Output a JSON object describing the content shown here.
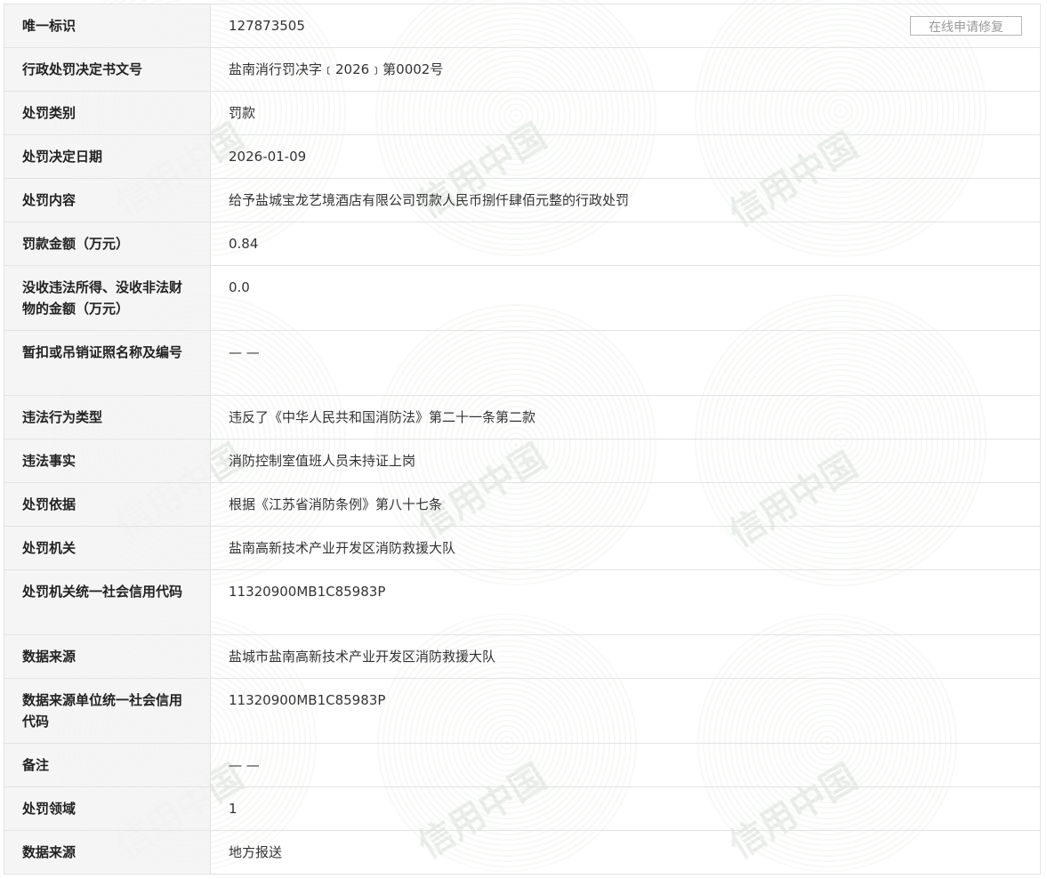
{
  "actions": {
    "repair_label": "在线申请修复"
  },
  "watermark": {
    "text": "信用中国"
  },
  "rows": [
    {
      "label": "唯一标识",
      "value": "127873505"
    },
    {
      "label": "行政处罚决定书文号",
      "value": "盐南消行罚决字﹝2026﹞第0002号"
    },
    {
      "label": "处罚类别",
      "value": "罚款"
    },
    {
      "label": "处罚决定日期",
      "value": "2026-01-09"
    },
    {
      "label": "处罚内容",
      "value": "给予盐城宝龙艺境酒店有限公司罚款人民币捌仟肆佰元整的行政处罚"
    },
    {
      "label": "罚款金额（万元）",
      "value": "0.84"
    },
    {
      "label": "没收违法所得、没收非法财物的金额（万元）",
      "value": "0.0"
    },
    {
      "label": "暂扣或吊销证照名称及编号",
      "value": "— —"
    },
    {
      "label": "违法行为类型",
      "value": "违反了《中华人民共和国消防法》第二十一条第二款"
    },
    {
      "label": "违法事实",
      "value": "消防控制室值班人员未持证上岗"
    },
    {
      "label": "处罚依据",
      "value": "根据《江苏省消防条例》第八十七条"
    },
    {
      "label": "处罚机关",
      "value": "盐南高新技术产业开发区消防救援大队"
    },
    {
      "label": "处罚机关统一社会信用代码",
      "value": "11320900MB1C85983P"
    },
    {
      "label": "数据来源",
      "value": "盐城市盐南高新技术产业开发区消防救援大队"
    },
    {
      "label": "数据来源单位统一社会信用代码",
      "value": "11320900MB1C85983P"
    },
    {
      "label": "备注",
      "value": "— —"
    },
    {
      "label": "处罚领域",
      "value": "1"
    },
    {
      "label": "数据来源",
      "value": "地方报送"
    }
  ]
}
